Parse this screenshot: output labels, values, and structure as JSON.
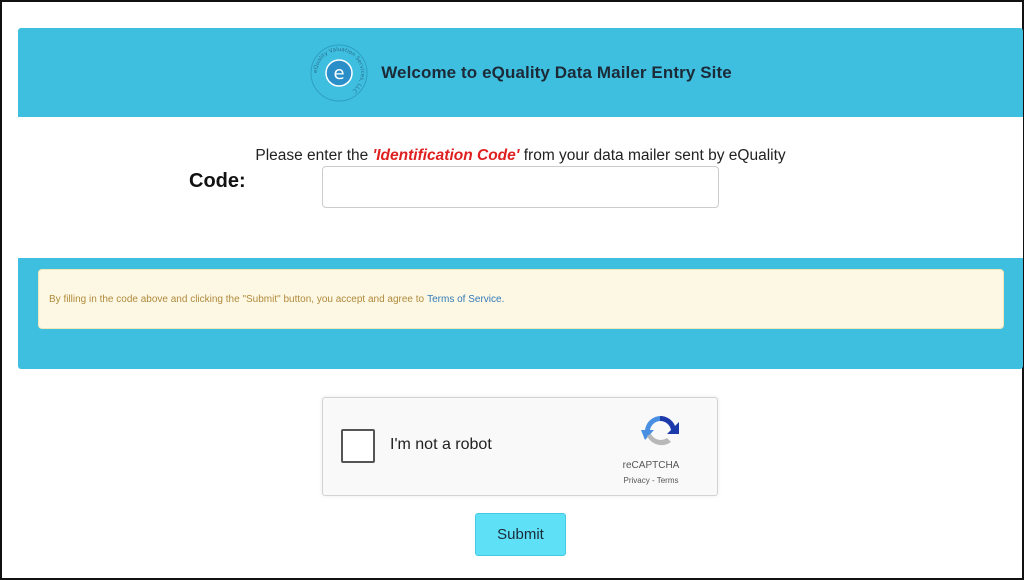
{
  "header": {
    "title": "Welcome to eQuality Data Mailer Entry Site",
    "logo_letter": "e",
    "logo_ring_text": "eQuality Valuation Services, LLC"
  },
  "form": {
    "prompt_before": "Please enter the ",
    "prompt_highlight": "'Identification Code'",
    "prompt_after": " from your data mailer sent by eQuality",
    "code_label": "Code:",
    "code_value": "",
    "code_placeholder": ""
  },
  "notice": {
    "text": "By filling in the code above and clicking the \"Submit\" button, you accept and agree to",
    "link_label": "Terms of Service."
  },
  "captcha": {
    "label": "I'm not a robot",
    "brand": "reCAPTCHA",
    "links": "Privacy - Terms",
    "checked": false
  },
  "submit": {
    "label": "Submit"
  },
  "colors": {
    "panel": "#3fbfdf",
    "highlight": "#e02020",
    "notice_bg": "#fdf8e4",
    "notice_text": "#b08a3c",
    "link": "#337ab7",
    "submit_bg": "#5ee0f7"
  }
}
